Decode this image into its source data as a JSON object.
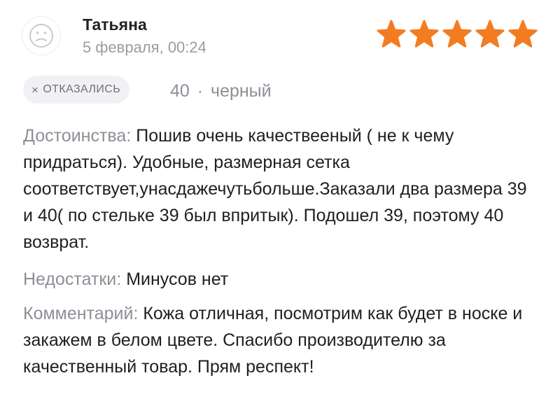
{
  "review": {
    "author": "Татьяна",
    "date": "5 февраля, 00:24",
    "rating": 5,
    "colors": {
      "star": "#f47c20",
      "label": "#8e8e97",
      "badge_bg": "#f1f1f5"
    },
    "status": {
      "icon": "close-icon",
      "x_glyph": "×",
      "label": "ОТКАЗАЛИСЬ"
    },
    "variant": {
      "size": "40",
      "separator": "·",
      "color": "черный"
    },
    "pros": {
      "label": "Достоинства:",
      "text": "Пошив очень качествееный ( не к чему придраться). Удобные, размерная сетка соответствует,унасдажечутьбольше.Заказали два размера 39 и 40( по стельке 39 был впритык). Подошел 39, поэтому 40 возврат."
    },
    "cons": {
      "label": "Недостатки:",
      "text": "Минусов нет"
    },
    "comment": {
      "label": "Комментарий:",
      "text": "Кожа отличная, посмотрим как будет в носке и закажем в белом цвете. Спасибо производителю за качественный товар. Прям респект!"
    }
  }
}
